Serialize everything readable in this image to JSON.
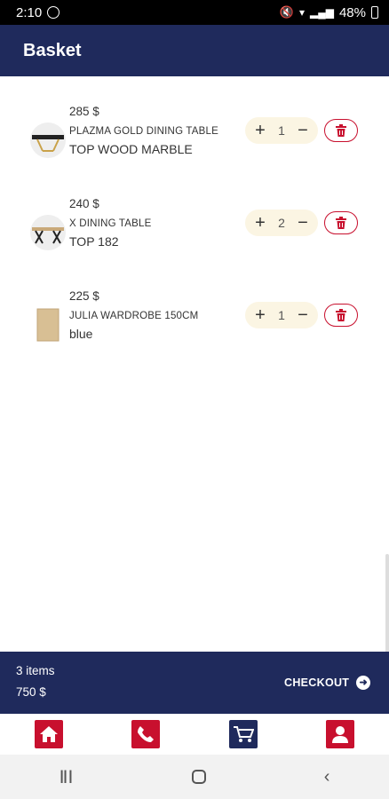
{
  "status_bar": {
    "time": "2:10",
    "battery": "48%"
  },
  "app_bar": {
    "title": "Basket"
  },
  "items": [
    {
      "price": "285 $",
      "name": "PLAZMA GOLD DINING TABLE",
      "variant": "TOP WOOD MARBLE",
      "qty": "1"
    },
    {
      "price": "240 $",
      "name": "X DINING TABLE",
      "variant": "TOP 182",
      "qty": "2"
    },
    {
      "price": "225 $",
      "name": "JULIA WARDROBE 150CM",
      "variant": "blue",
      "qty": "1"
    }
  ],
  "footer": {
    "count": "3 items",
    "total": "750 $",
    "checkout_label": "CHECKOUT"
  },
  "nav": [
    "home-icon",
    "phone-icon",
    "cart-icon",
    "user-icon"
  ],
  "colors": {
    "primary": "#1f2a5c",
    "accent": "#c8102e",
    "stepper_bg": "#fbf5e3"
  }
}
